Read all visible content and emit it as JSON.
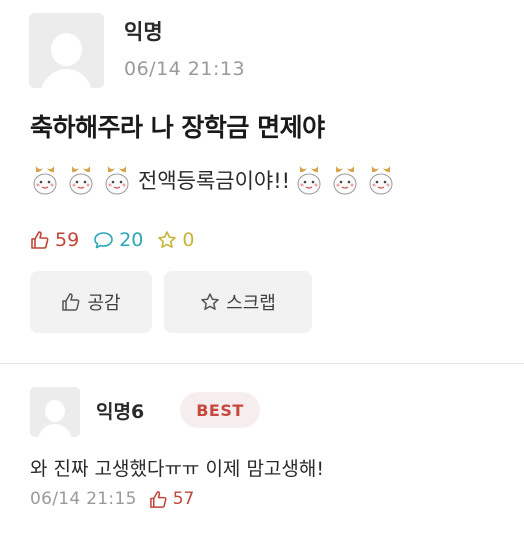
{
  "post": {
    "author": "익명",
    "time": "06/14 21:13",
    "title": "축하해주라 나 장학금 면제야",
    "content_text": "전액등록금이야!!",
    "emoji_name": "celebrating-character-emoji",
    "stats": {
      "likes": "59",
      "comments": "20",
      "scraps": "0"
    },
    "like_button_label": "공감",
    "scrap_button_label": "스크랩"
  },
  "comment": {
    "author": "익명6",
    "badge": "BEST",
    "text": "와 진짜 고생했다ㅠㅠ 이제 맘고생해!",
    "time": "06/14 21:15",
    "likes": "57"
  },
  "colors": {
    "like": "#c0463a",
    "comment": "#2ba7b7",
    "scrap": "#c8b43a",
    "badge_bg": "#f6eeee",
    "meta_gray": "#9a9a9a"
  }
}
